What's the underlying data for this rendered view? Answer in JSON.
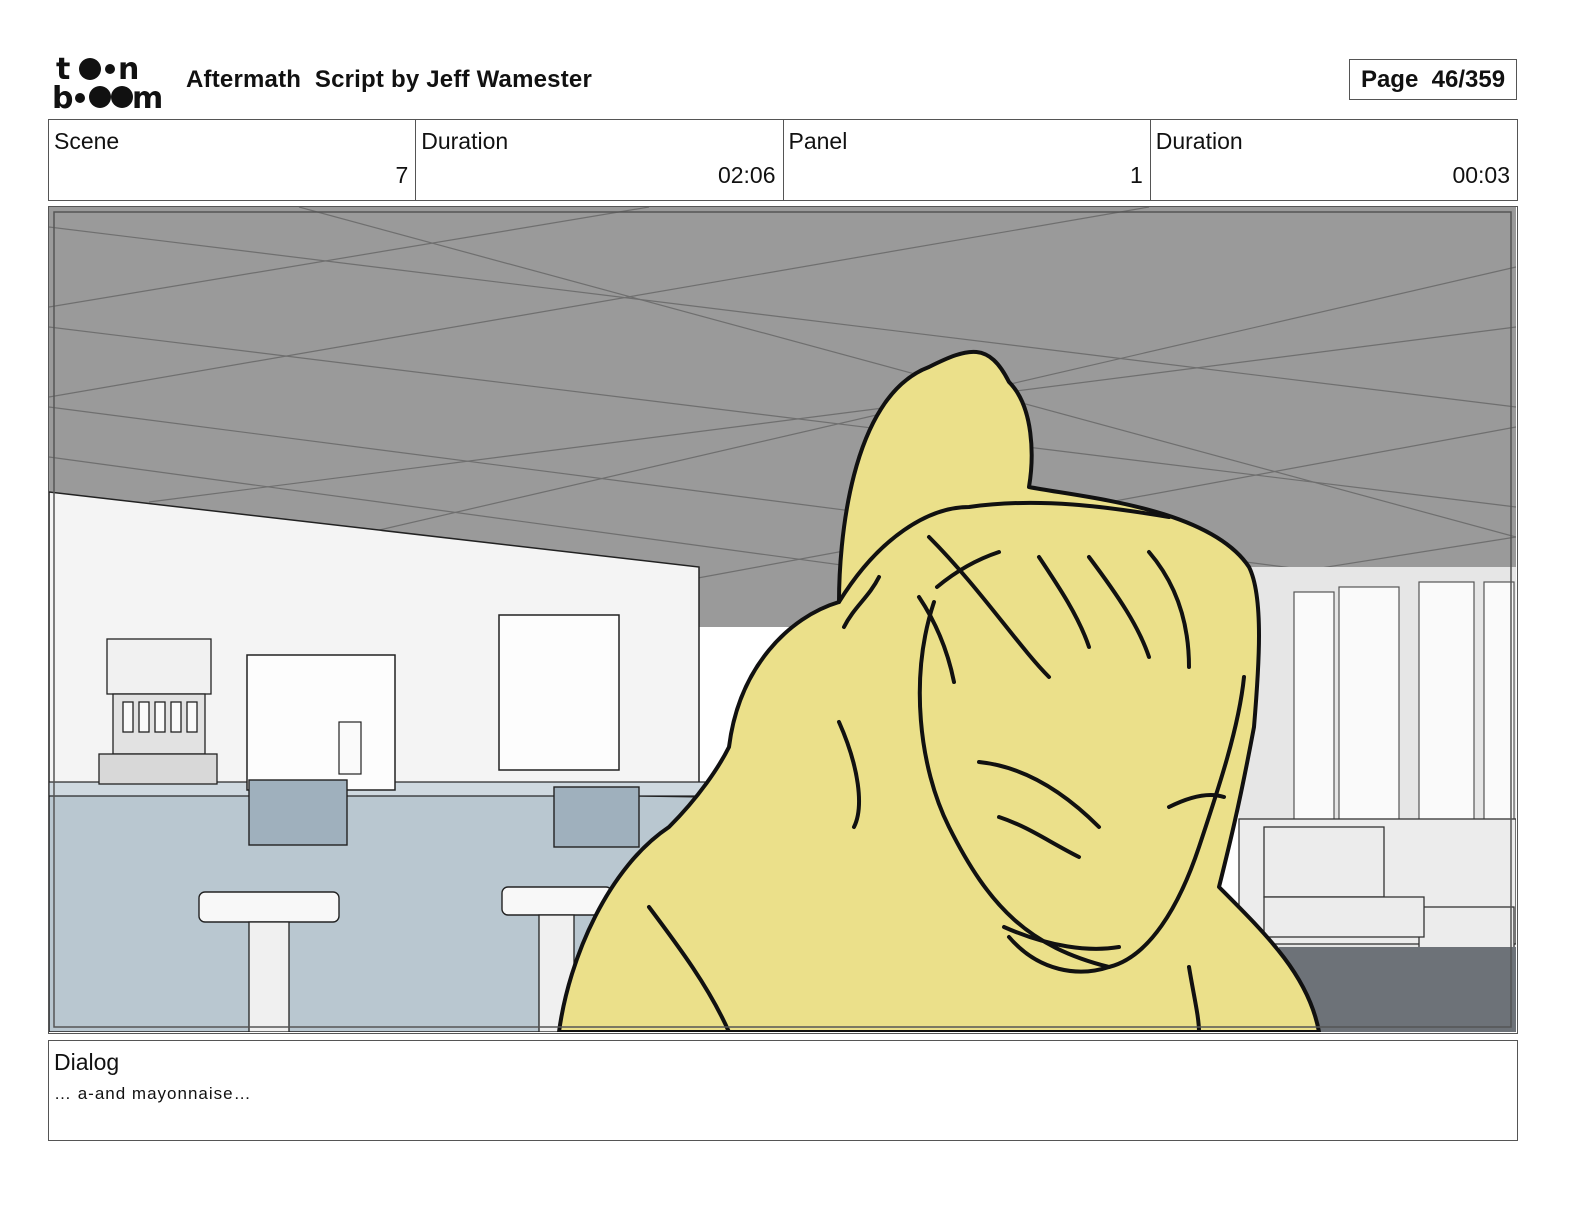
{
  "header": {
    "logo_text": "toon boom",
    "title": "Aftermath  Script by Jeff Wamester",
    "page_label": "Page  46/359"
  },
  "info": [
    {
      "label": "Scene",
      "value": "7"
    },
    {
      "label": "Duration",
      "value": "02:06"
    },
    {
      "label": "Panel",
      "value": "1"
    },
    {
      "label": "Duration",
      "value": "00:03"
    }
  ],
  "panel": {
    "description_icon": "storyboard-drawing",
    "colors": {
      "ceiling": "#9a9a9a",
      "wall": "#f5f5f5",
      "counter": "#b9c7d0",
      "character": "#ebe08a"
    }
  },
  "dialog": {
    "label": "Dialog",
    "text": "…  a-and mayonnaise…"
  }
}
